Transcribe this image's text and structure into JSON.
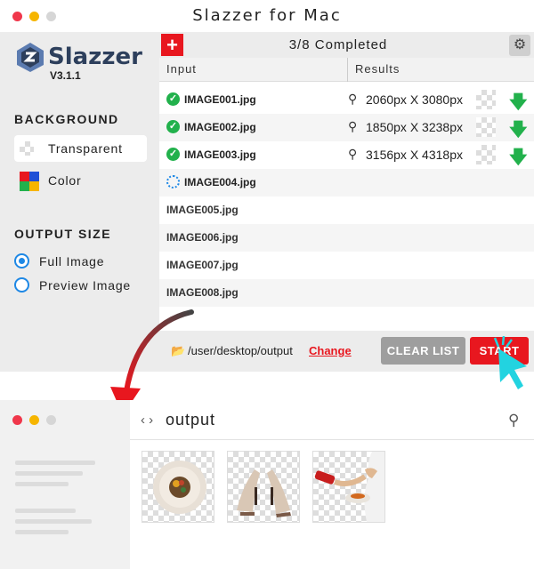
{
  "app": {
    "title": "Slazzer for Mac",
    "logo": "Slazzer",
    "version": "V3.1.1"
  },
  "sidebar": {
    "background_heading": "BACKGROUND",
    "background_options": [
      {
        "label": "Transparent",
        "selected": true,
        "icon": "transparent-swatch-icon"
      },
      {
        "label": "Color",
        "selected": false,
        "icon": "color-swatch-icon"
      }
    ],
    "output_heading": "OUTPUT SIZE",
    "output_options": [
      {
        "label": "Full Image",
        "selected": true
      },
      {
        "label": "Preview Image",
        "selected": false
      }
    ]
  },
  "main": {
    "status": "3/8 Completed",
    "col_input": "Input",
    "col_results": "Results",
    "rows": [
      {
        "name": "IMAGE001.jpg",
        "state": "done",
        "result": "2060px X 3080px"
      },
      {
        "name": "IMAGE002.jpg",
        "state": "done",
        "result": "1850px X 3238px"
      },
      {
        "name": "IMAGE003.jpg",
        "state": "done",
        "result": "3156px X 4318px"
      },
      {
        "name": "IMAGE004.jpg",
        "state": "processing",
        "result": ""
      },
      {
        "name": "IMAGE005.jpg",
        "state": "queued",
        "result": ""
      },
      {
        "name": "IMAGE006.jpg",
        "state": "queued",
        "result": ""
      },
      {
        "name": "IMAGE007.jpg",
        "state": "queued",
        "result": ""
      },
      {
        "name": "IMAGE008.jpg",
        "state": "queued",
        "result": ""
      }
    ],
    "output_path": "/user/desktop/output",
    "change_label": "Change",
    "clear_label": "CLEAR LIST",
    "start_label": "START"
  },
  "finder": {
    "folder": "output",
    "files": [
      "food-plate-image",
      "sandals-image",
      "person-pouring-image"
    ]
  },
  "colors": {
    "accent": "#e8171f",
    "success": "#22b14c",
    "radio": "#1e88e5",
    "logo": "#2d3f5c",
    "cursor": "#22d3e0"
  }
}
